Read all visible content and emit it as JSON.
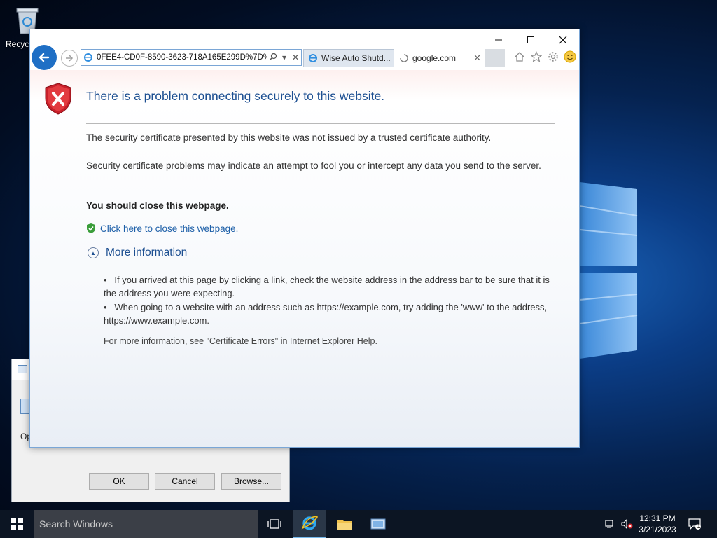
{
  "desktop": {
    "recycle_bin_label": "Recycl"
  },
  "run_dialog": {
    "label_partial": "Op",
    "ok_label": "OK",
    "cancel_label": "Cancel",
    "browse_label": "Browse..."
  },
  "browser": {
    "address": "0FEE4-CD0F-8590-3623-718A165E299D%7D%",
    "tabs": [
      {
        "label": "Wise Auto Shutd..."
      },
      {
        "label": "google.com"
      }
    ]
  },
  "error_page": {
    "title": "There is a problem connecting securely to this website.",
    "p1": "The security certificate presented by this website was not issued by a trusted certificate authority.",
    "p2": "Security certificate problems may indicate an attempt to fool you or intercept any data you send to the server.",
    "p3": "You should close this webpage.",
    "close_link": "Click here to close this webpage.",
    "more_info": "More information",
    "bullets": [
      "If you arrived at this page by clicking a link, check the website address in the address bar to be sure that it is the address you were expecting.",
      "When going to a website with an address such as https://example.com, try adding the 'www' to the address, https://www.example.com."
    ],
    "footer": "For more information, see \"Certificate Errors\" in Internet Explorer Help."
  },
  "taskbar": {
    "search_placeholder": "Search Windows",
    "time": "12:31 PM",
    "date": "3/21/2023",
    "notification_count": "1"
  },
  "colors": {
    "link": "#1d5fa8",
    "title": "#1d4f91",
    "back_button": "#1f6fc5"
  }
}
